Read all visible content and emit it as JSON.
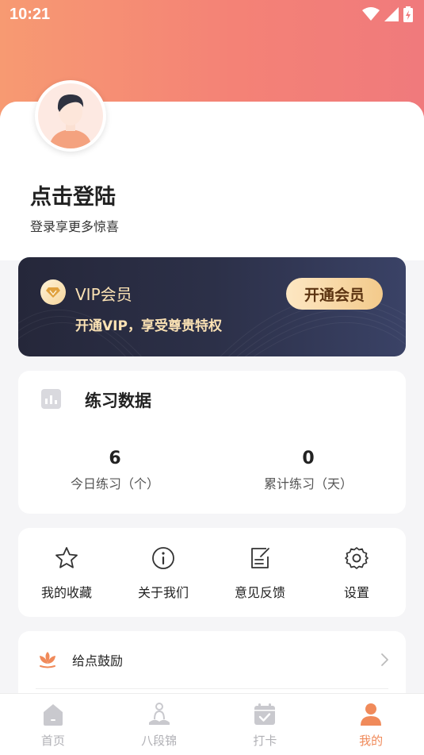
{
  "status_bar": {
    "time": "10:21"
  },
  "profile": {
    "title": "点击登陆",
    "subtitle": "登录享更多惊喜"
  },
  "vip": {
    "title": "VIP会员",
    "description": "开通VIP，享受尊贵特权",
    "button_label": "开通会员"
  },
  "practice": {
    "title": "练习数据",
    "stats": [
      {
        "value": "6",
        "label": "今日练习（个）"
      },
      {
        "value": "0",
        "label": "累计练习（天）"
      }
    ]
  },
  "menu": [
    {
      "label": "我的收藏",
      "icon": "star-icon"
    },
    {
      "label": "关于我们",
      "icon": "info-icon"
    },
    {
      "label": "意见反馈",
      "icon": "feedback-icon"
    },
    {
      "label": "设置",
      "icon": "gear-icon"
    }
  ],
  "list": [
    {
      "label": "给点鼓励",
      "icon": "lotus-icon"
    }
  ],
  "tabs": [
    {
      "label": "首页",
      "icon": "home-icon",
      "active": false
    },
    {
      "label": "八段锦",
      "icon": "meditation-icon",
      "active": false
    },
    {
      "label": "打卡",
      "icon": "calendar-check-icon",
      "active": false
    },
    {
      "label": "我的",
      "icon": "person-icon",
      "active": true
    }
  ],
  "colors": {
    "header_gradient_start": "#f79a72",
    "header_gradient_end": "#f07a7c",
    "accent": "#f08a5a",
    "vip_gold": "#fbe2b4"
  }
}
